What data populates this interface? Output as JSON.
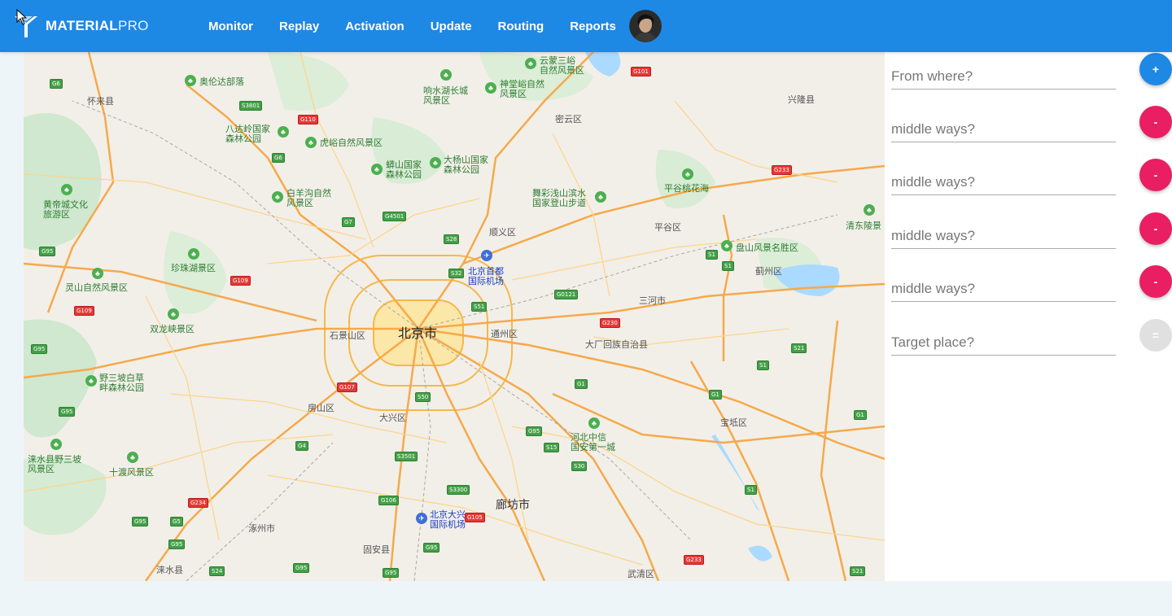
{
  "header": {
    "brand_bold": "MATERIAL",
    "brand_light": "PRO",
    "nav": [
      "Monitor",
      "Replay",
      "Activation",
      "Update",
      "Routing",
      "Reports"
    ],
    "colors": {
      "primary": "#1e88e5"
    }
  },
  "map": {
    "labels": {
      "beijing": "北京市",
      "langfang": "廊坊市",
      "shunyi": "顺义区",
      "tongzhou": "通州区",
      "daxing": "大兴区",
      "fangshan": "房山区",
      "shijingshan": "石景山区",
      "pinggu": "平谷区",
      "miyun": "密云区",
      "sanhe": "三河市",
      "dachang": "大厂回族自治县",
      "baodi": "宝坻区",
      "zhuozhou": "涿州市",
      "guan": "固安县",
      "wuqing": "武清区",
      "jizhou": "蓟州区",
      "huailai": "怀来县",
      "xinglong": "兴隆县",
      "laishui": "涞水县",
      "airport_capital": "北京首都\n国际机场",
      "airport_daxing": "北京大兴\n国际机场",
      "badaling": "八达岭国家\n森林公园",
      "baiyanggou": "白羊沟自然\n风景区",
      "huyu": "虎峪自然风景区",
      "mangshan": "蟒山国家\n森林公园",
      "dayangshan": "大杨山国家\n森林公园",
      "xiangshuihu": "响水湖长城\n风景区",
      "shentangyu": "神堂峪自然\n风景区",
      "yunmeng": "云蒙三峪\n自然风景区",
      "wucai": "舞彩浅山滨水\n国家登山步道",
      "pinggu_peach": "平谷桃花海",
      "panshan": "盘山风景名胜区",
      "qingdongling": "清东陵景",
      "huangdicheng": "黄帝城文化\n旅游区",
      "zhenzhu": "珍珠湖景区",
      "lingshan": "灵山自然风景区",
      "shuanglong": "双龙峡景区",
      "yesanpo": "野三坡白草\n畔森林公园",
      "laishui_yesanpo": "涞水县野三坡\n风景区",
      "shidu": "十渡风景区",
      "hebei_zhongxin": "河北中信\n国安第一城",
      "aolunda": "奥伦达部落"
    }
  },
  "route": {
    "rows": [
      {
        "placeholder": "From where?",
        "button": "+",
        "kind": "plus"
      },
      {
        "placeholder": "middle ways?",
        "button": "-",
        "kind": "minus"
      },
      {
        "placeholder": "middle ways?",
        "button": "-",
        "kind": "minus"
      },
      {
        "placeholder": "middle ways?",
        "button": "-",
        "kind": "minus"
      },
      {
        "placeholder": "middle ways?",
        "button": "-",
        "kind": "minus"
      },
      {
        "placeholder": "Target place?",
        "button": "=",
        "kind": "eq"
      }
    ]
  }
}
